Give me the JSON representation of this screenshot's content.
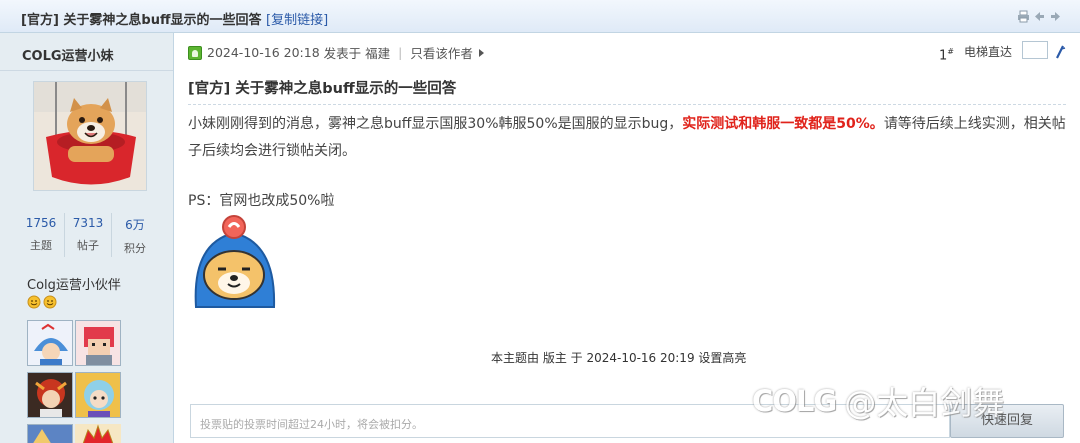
{
  "thread": {
    "title": "[官方] 关于雾神之息buff显示的一些回答",
    "copy_link_label": "[复制链接]"
  },
  "author": {
    "name": "COLG运营小妹",
    "stats": [
      {
        "value": "1756",
        "label": "主题"
      },
      {
        "value": "7313",
        "label": "帖子"
      },
      {
        "value": "6万",
        "label": "积分"
      }
    ],
    "group": "Colg运营小伙伴"
  },
  "post": {
    "datetime": "2024-10-16 20:18",
    "posted_in_label": "发表于",
    "location": "福建",
    "author_only_label": "只看该作者",
    "floor_number": "1",
    "floor_suffix": "#",
    "jump_label": "电梯直达",
    "title": "[官方] 关于雾神之息buff显示的一些回答",
    "body_text_1": "小妹刚刚得到的消息，雾神之息buff显示国服30%韩服50%是国服的显示bug，",
    "body_highlight": "实际测试和韩服一致都是50%。",
    "body_text_2": "请等待后续上线实测，相关帖子后续均会进行锁帖关闭。",
    "ps_text": "PS：官网也改成50%啦"
  },
  "moderation_note": "本主题由 版主 于 2024-10-16 20:19 设置高亮",
  "reply": {
    "placeholder": "投票贴的投票时间超过24小时，将会被扣分。",
    "button_label": "快速回复"
  },
  "watermark": {
    "logo": "COLG",
    "text": "@太白剑舞"
  }
}
